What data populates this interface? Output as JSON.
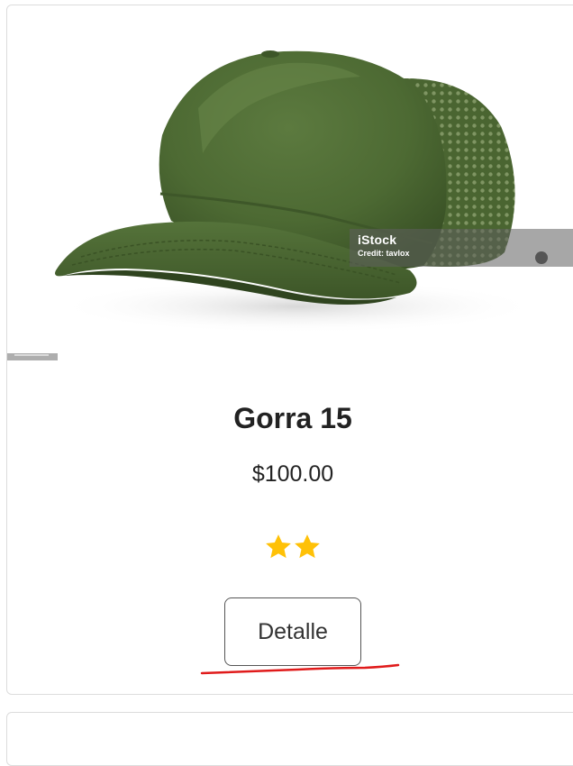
{
  "product": {
    "title": "Gorra 15",
    "price": "$100.00",
    "rating": 2,
    "button_label": "Detalle"
  },
  "watermark": {
    "brand": "iStock",
    "credit": "Credit: tavlox"
  },
  "colors": {
    "cap_green": "#4f6b35",
    "star_yellow": "#ffc107",
    "annotation_red": "#e01b1b",
    "card_border": "#dcdcdc"
  },
  "icons": {
    "star": "star-icon"
  }
}
